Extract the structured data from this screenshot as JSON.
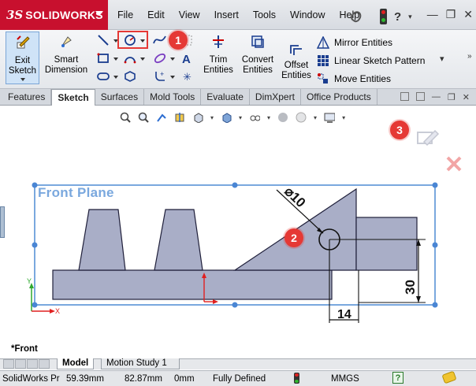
{
  "app": {
    "logo_prefix": "3S",
    "logo_name": "SOLIDWORKS"
  },
  "menu": [
    "File",
    "Edit",
    "View",
    "Insert",
    "Tools",
    "Window",
    "Help"
  ],
  "ribbon": {
    "exit_sketch": "Exit\nSketch",
    "smart_dimension": "Smart\nDimension",
    "trim_entities": "Trim\nEntities",
    "convert_entities": "Convert\nEntities",
    "offset_entities": "Offset\nEntities",
    "mirror_entities": "Mirror Entities",
    "linear_sketch_pattern": "Linear Sketch Pattern",
    "move_entities": "Move Entities"
  },
  "tabs": [
    {
      "label": "Features",
      "active": false
    },
    {
      "label": "Sketch",
      "active": true
    },
    {
      "label": "Surfaces",
      "active": false
    },
    {
      "label": "Mold Tools",
      "active": false
    },
    {
      "label": "Evaluate",
      "active": false
    },
    {
      "label": "DimXpert",
      "active": false
    },
    {
      "label": "Office Products",
      "active": false
    }
  ],
  "canvas": {
    "plane_label": "Front Plane",
    "view_label": "*Front",
    "dim_diameter": "⌀10",
    "dim_vertical": "30",
    "dim_horizontal": "14",
    "axis_x": "X",
    "axis_y": "Y"
  },
  "badges": {
    "one": "1",
    "two": "2",
    "three": "3"
  },
  "bottom_tabs": {
    "model": "Model",
    "motion": "Motion Study 1"
  },
  "status": {
    "app": "SolidWorks Pr",
    "x": "59.39mm",
    "y": "82.87mm",
    "z": "0mm",
    "state": "Fully Defined",
    "units": "MMGS"
  },
  "colors": {
    "accent_red": "#e53935",
    "sketch_fill": "#a9aec7",
    "sketch_line": "#1f1f3a",
    "plane_blue": "#7aa8de"
  }
}
